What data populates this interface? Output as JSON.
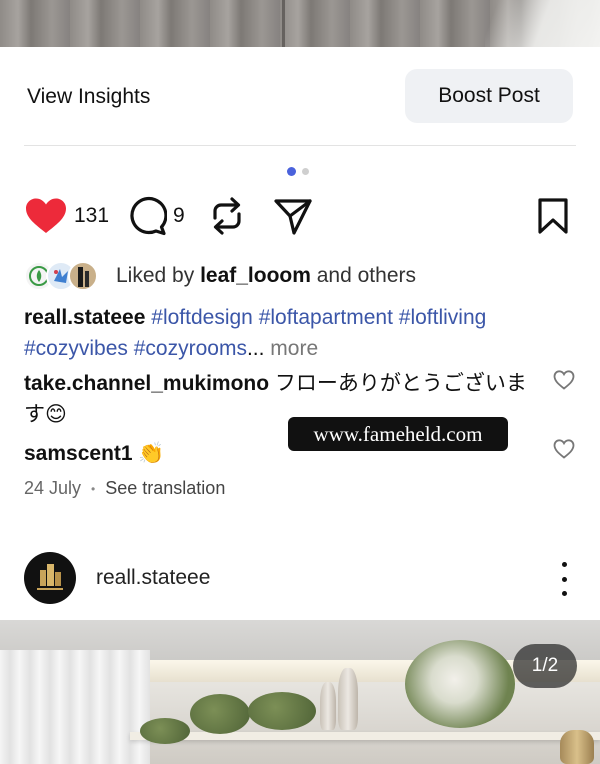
{
  "insights": {
    "view_label": "View Insights",
    "boost_label": "Boost Post"
  },
  "carousel": {
    "active_index": 0,
    "total": 2
  },
  "actions": {
    "like_count": "131",
    "comment_count": "9",
    "like_color": "#ed2a3a"
  },
  "liked_by": {
    "prefix": "Liked by ",
    "user": "leaf_looom",
    "suffix": " and others"
  },
  "caption": {
    "user": "reall.stateee",
    "hashtags": [
      "#loftdesign",
      "#loftapartment",
      "#loftliving",
      "#cozyvibes",
      "#cozyrooms"
    ],
    "ellipsis": "...",
    "more_label": "more"
  },
  "comments": [
    {
      "user": "take.channel_mukimono",
      "text": "フローありがとうございます😊"
    },
    {
      "user": "samscent1",
      "text": "👏"
    }
  ],
  "meta": {
    "date": "24 July",
    "separator": "•",
    "translate_label": "See translation"
  },
  "watermark": "www.fameheld.com",
  "next_post": {
    "username": "reall.stateee",
    "page_indicator": "1/2"
  },
  "icons": {
    "like": "heart-icon",
    "comment": "comment-icon",
    "repost": "repost-icon",
    "share": "send-icon",
    "save": "bookmark-icon",
    "more": "more-vertical-icon"
  },
  "colors": {
    "hashtag": "#3b56a8",
    "carousel_active": "#4a62dc",
    "boost_bg": "#eff1f4"
  }
}
